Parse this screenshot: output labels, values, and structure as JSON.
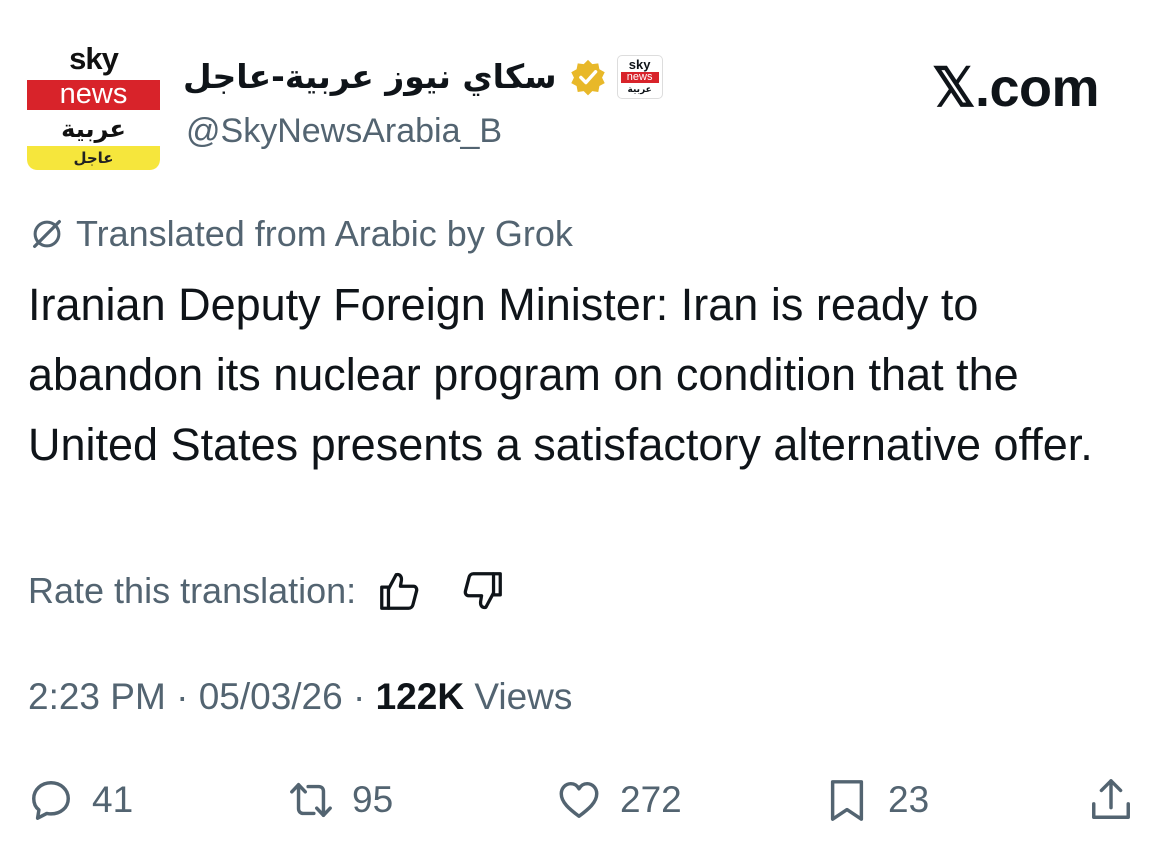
{
  "avatar": {
    "sky": "sky",
    "news": "news",
    "arabic": "عربية",
    "breaking": "عاجل"
  },
  "account": {
    "display_name": "سكاي نيوز عربية-عاجل",
    "handle": "@SkyNewsArabia_B",
    "verified_color": "#e8b829",
    "small_logo": {
      "sky": "sky",
      "news": "news",
      "arabic": "عربية"
    }
  },
  "watermark": "𝕏.com",
  "translation_notice": "Translated from Arabic by Grok",
  "tweet_text": "Iranian Deputy Foreign Minister: Iran is ready to abandon its nuclear program on condition that the United States presents a satisfactory alternative offer.",
  "rate_label": "Rate this translation:",
  "meta": {
    "time": "2:23 PM",
    "date": "05/03/26",
    "views_count": "122K",
    "views_label": "Views"
  },
  "actions": {
    "replies": "41",
    "reposts": "95",
    "likes": "272",
    "bookmarks": "23"
  },
  "colors": {
    "brand_red": "#d8232a",
    "brand_yellow": "#f6e63c",
    "secondary_text": "#536471",
    "primary_text": "#0f1419"
  }
}
